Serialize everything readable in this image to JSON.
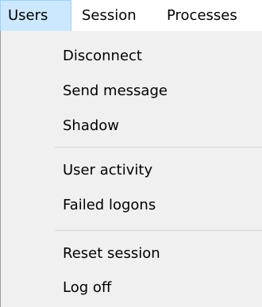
{
  "menubar": {
    "items": [
      {
        "label": "Users",
        "active": true
      },
      {
        "label": "Session"
      },
      {
        "label": "Processes"
      }
    ]
  },
  "dropdown": {
    "groups": [
      {
        "items": [
          "Disconnect",
          "Send message",
          "Shadow"
        ]
      },
      {
        "items": [
          "User activity",
          "Failed logons"
        ]
      },
      {
        "items": [
          "Reset session",
          "Log off"
        ]
      }
    ]
  },
  "colors": {
    "active_menu_bg": "#cce8ff",
    "active_menu_border": "#99d1ff",
    "dropdown_bg": "#f0f0f0",
    "separator": "#d7d7d7"
  }
}
